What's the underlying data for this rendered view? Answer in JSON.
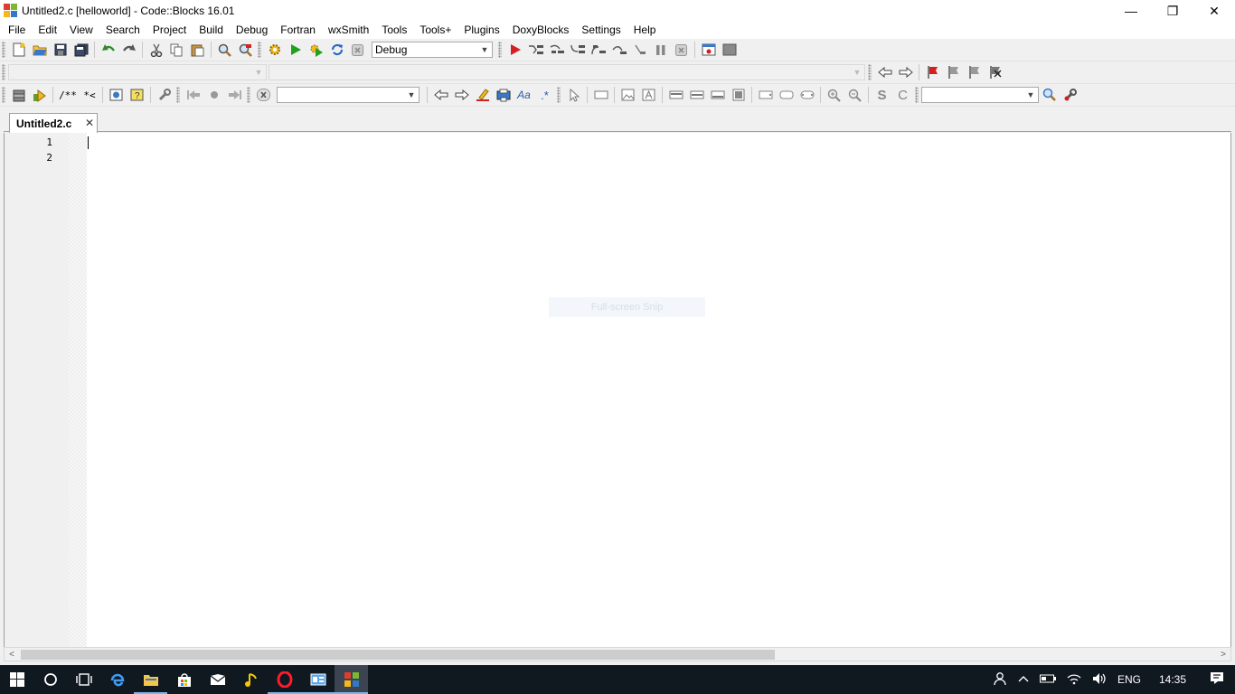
{
  "window": {
    "title": "Untitled2.c [helloworld] - Code::Blocks 16.01",
    "controls": {
      "minimize": "—",
      "maximize": "❐",
      "close": "✕"
    }
  },
  "menu": [
    "File",
    "Edit",
    "View",
    "Search",
    "Project",
    "Build",
    "Debug",
    "Fortran",
    "wxSmith",
    "Tools",
    "Tools+",
    "Plugins",
    "DoxyBlocks",
    "Settings",
    "Help"
  ],
  "toolbar": {
    "build_target": "Debug",
    "doxy_comment": "/**",
    "doxy_line": "*<"
  },
  "tabs": [
    {
      "label": "Untitled2.c",
      "close": "✕"
    }
  ],
  "editor": {
    "line_numbers": [
      "1",
      "2"
    ],
    "snip_hint": "Full-screen Snip"
  },
  "scrollbar": {
    "left_arrow": "<",
    "right_arrow": ">"
  },
  "taskbar": {
    "tray": {
      "language": "ENG",
      "time": "14:35"
    }
  },
  "icons": {
    "accent_green": "#22e05a",
    "run_green": "#1fa01f",
    "debug_red": "#d42020",
    "taskbar_bg": "#101820"
  }
}
